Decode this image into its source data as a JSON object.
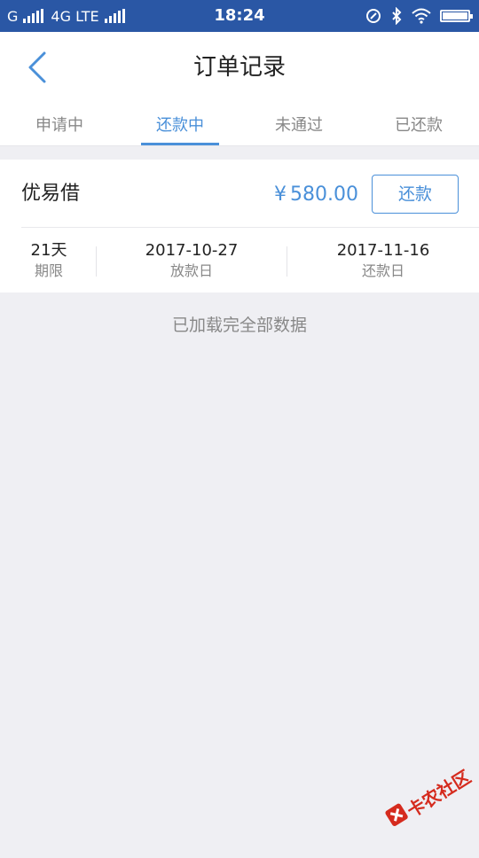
{
  "status_bar": {
    "carrier_left": "G",
    "network": "4G LTE",
    "time": "18:24"
  },
  "header": {
    "title": "订单记录",
    "back_icon": "chevron-left-icon"
  },
  "tabs": [
    {
      "label": "申请中",
      "active": false
    },
    {
      "label": "还款中",
      "active": true
    },
    {
      "label": "未通过",
      "active": false
    },
    {
      "label": "已还款",
      "active": false
    }
  ],
  "order": {
    "lender": "优易借",
    "currency_symbol": "¥",
    "amount": "580.00",
    "repay_label": "还款",
    "term_value": "21天",
    "term_label": "期限",
    "loan_date_value": "2017-10-27",
    "loan_date_label": "放款日",
    "due_date_value": "2017-11-16",
    "due_date_label": "还款日"
  },
  "list_footer": "已加载完全部数据",
  "watermark": {
    "text": "卡农社区"
  },
  "colors": {
    "status_bar": "#2a57a5",
    "accent": "#4a90d9",
    "background": "#efeff3",
    "watermark": "#d52b1e"
  }
}
